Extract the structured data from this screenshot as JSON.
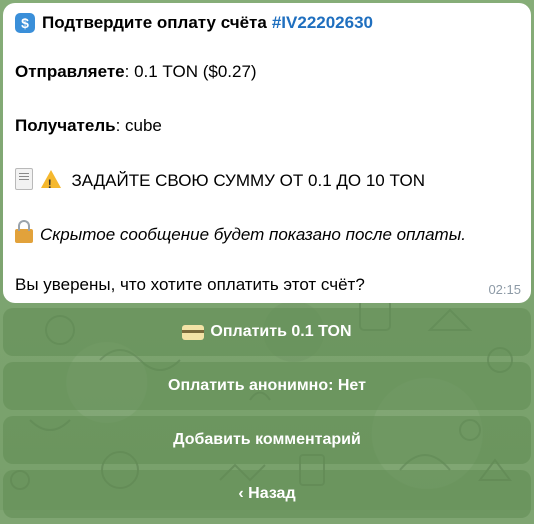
{
  "message": {
    "title_icon": "dollar-icon",
    "title_text": "Подтвердите оплату счёта",
    "invoice_id": "#IV22202630",
    "sender_label": "Отправляете",
    "sender_value": ": 0.1 TON ($0.27)",
    "recipient_label": "Получатель",
    "recipient_value": ": cube",
    "amount_range": "ЗАДАЙТЕ СВОЮ СУММУ ОТ 0.1 ДО 10 TON",
    "hidden_note": "Скрытое сообщение будет показано после оплаты.",
    "question": "Вы уверены, что хотите оплатить этот счёт?",
    "time": "02:15"
  },
  "buttons": {
    "pay_label": "Оплатить 0.1 TON",
    "anon_label": "Оплатить анонимно: Нет",
    "comment_label": "Добавить комментарий",
    "back_label": "‹ Назад"
  },
  "colors": {
    "link": "#1f6fbf",
    "background": "#7fa572",
    "button": "#6f9a63"
  }
}
